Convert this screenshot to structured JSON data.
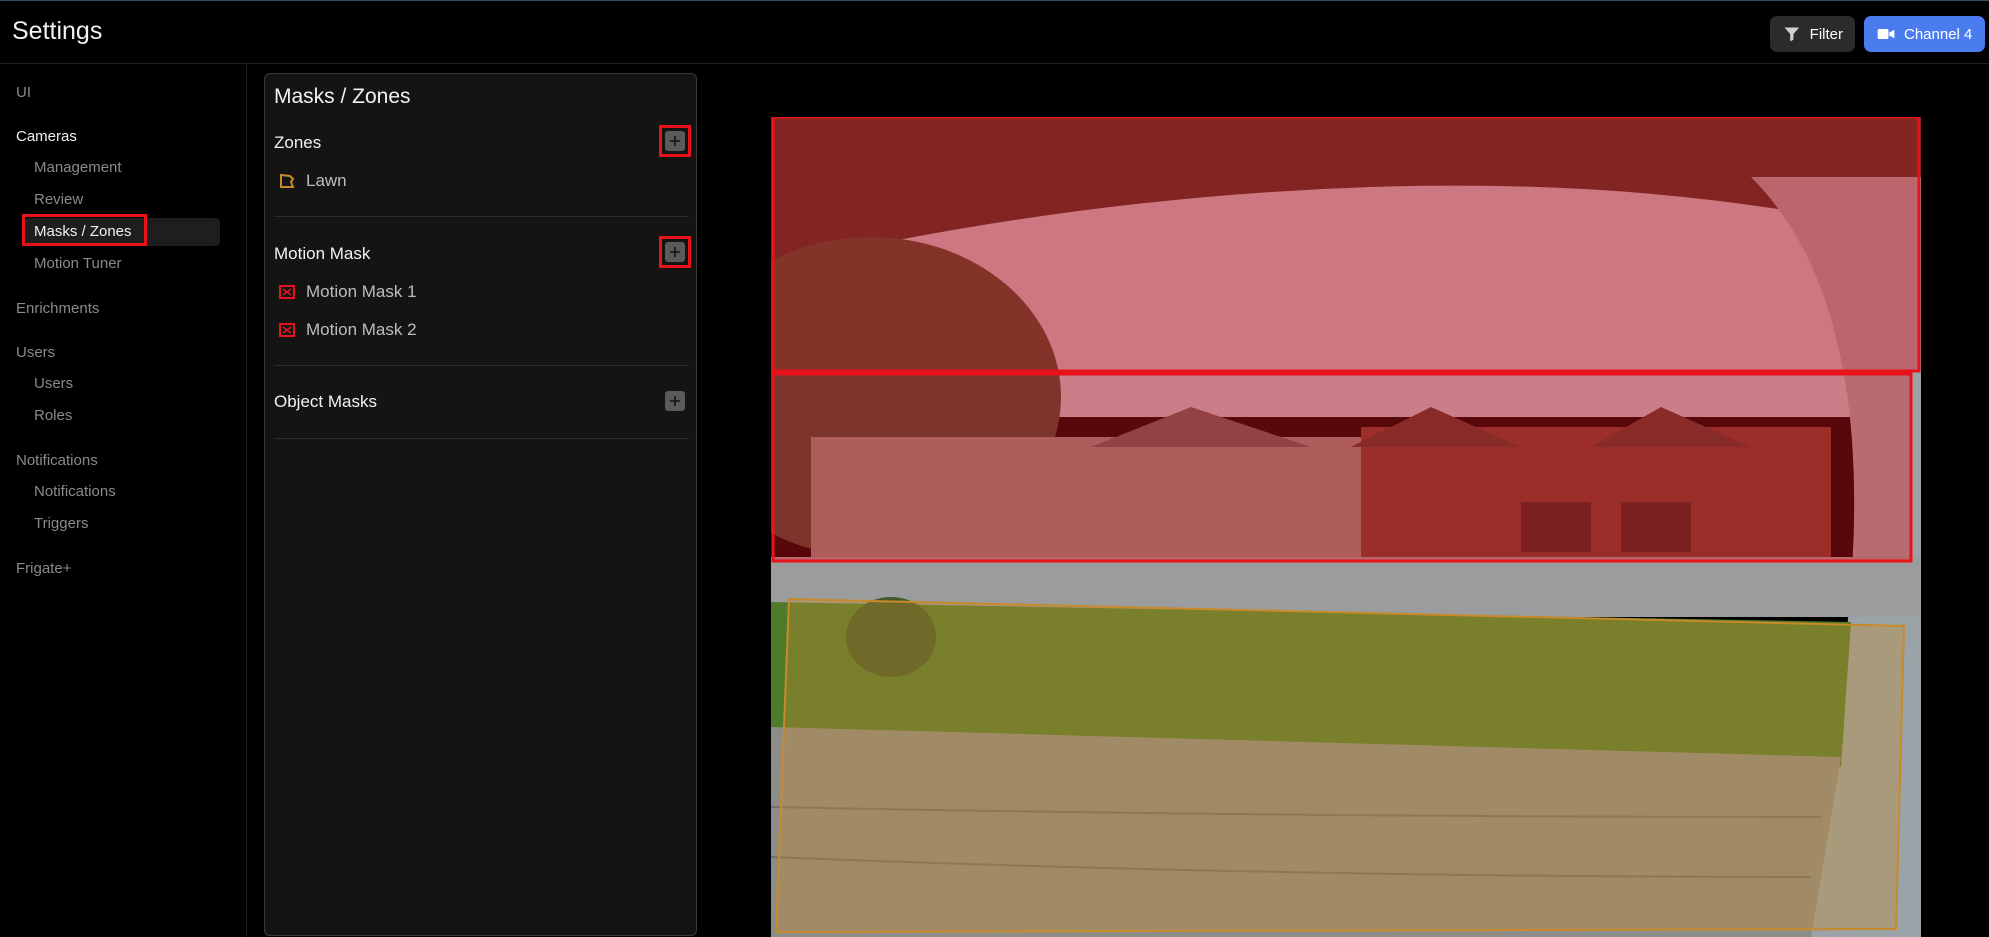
{
  "header": {
    "title": "Settings",
    "filter_label": "Filter",
    "channel_label": "Channel 4",
    "colors": {
      "channel_button": "#4a7cf0",
      "filter_button": "#2b2b2b"
    }
  },
  "sidebar": {
    "groups": [
      {
        "label": "UI",
        "items": []
      },
      {
        "label": "Cameras",
        "active": true,
        "items": [
          "Management",
          "Review",
          "Masks / Zones",
          "Motion Tuner"
        ]
      },
      {
        "label": "Enrichments",
        "items": []
      },
      {
        "label": "Users",
        "items": [
          "Users",
          "Roles"
        ]
      },
      {
        "label": "Notifications",
        "items": [
          "Notifications",
          "Triggers"
        ]
      },
      {
        "label": "Frigate+",
        "items": []
      }
    ],
    "selected_item": "Masks / Zones"
  },
  "panel": {
    "title": "Masks / Zones",
    "zones": {
      "title": "Zones",
      "items": [
        {
          "label": "Lawn",
          "icon": "zone-polygon-icon",
          "color": "#c88a2a"
        }
      ]
    },
    "motion_mask": {
      "title": "Motion Mask",
      "items": [
        {
          "label": "Motion Mask 1",
          "icon": "mask-polygon-icon",
          "color": "#e8121b"
        },
        {
          "label": "Motion Mask 2",
          "icon": "mask-polygon-icon",
          "color": "#e8121b"
        }
      ]
    },
    "object_masks": {
      "title": "Object Masks",
      "items": []
    }
  },
  "camera_view": {
    "overlays": [
      {
        "name": "motion-mask-1",
        "color": "#e8121b"
      },
      {
        "name": "motion-mask-2",
        "color": "#e8121b"
      },
      {
        "name": "zone-lawn",
        "color": "#c88a2a"
      }
    ]
  },
  "highlight_color": "#e8121b"
}
